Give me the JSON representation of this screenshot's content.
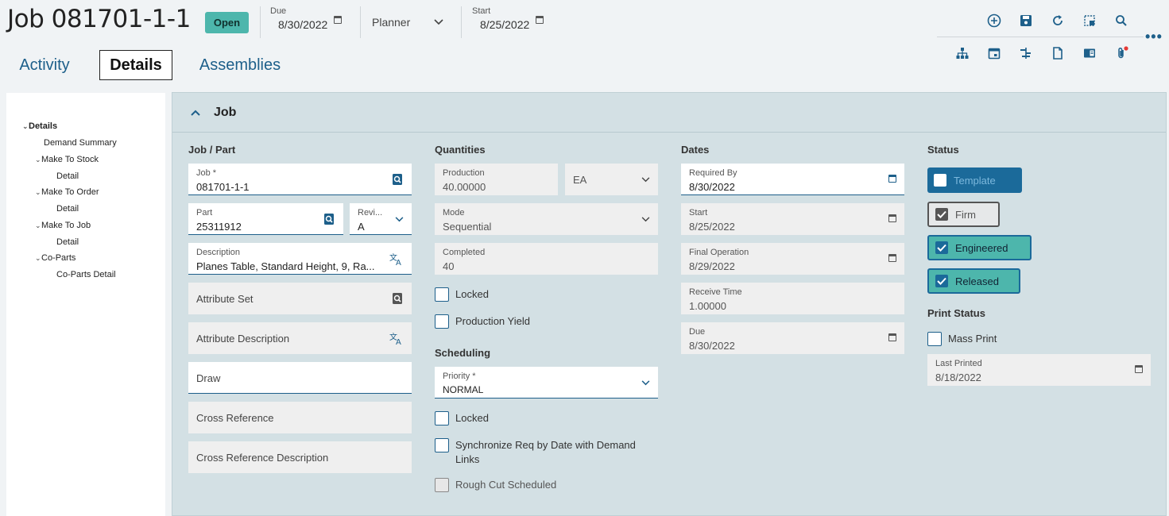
{
  "header": {
    "title": "Job 081701-1-1",
    "badge": "Open",
    "due_label": "Due",
    "due_value": "8/30/2022",
    "planner_label": "Planner",
    "start_label": "Start",
    "start_value": "8/25/2022"
  },
  "tabs": [
    {
      "label": "Activity"
    },
    {
      "label": "Details"
    },
    {
      "label": "Assemblies"
    }
  ],
  "tree": {
    "items": [
      {
        "label": "Details"
      },
      {
        "label": "Demand Summary"
      },
      {
        "label": "Make To Stock"
      },
      {
        "label": "Detail"
      },
      {
        "label": "Make To Order"
      },
      {
        "label": "Detail"
      },
      {
        "label": "Make To Job"
      },
      {
        "label": "Detail"
      },
      {
        "label": "Co-Parts"
      },
      {
        "label": "Co-Parts Detail"
      }
    ]
  },
  "panel": {
    "title": "Job",
    "job_part": {
      "section": "Job / Part",
      "job_label": "Job *",
      "job_value": "081701-1-1",
      "part_label": "Part",
      "part_value": "25311912",
      "rev_label": "Revi...",
      "rev_value": "A",
      "desc_label": "Description",
      "desc_value": "Planes Table, Standard Height, 9, Ra...",
      "attr_set": "Attribute Set",
      "attr_desc": "Attribute Description",
      "draw": "Draw",
      "cross_ref": "Cross Reference",
      "cross_ref_desc": "Cross Reference Description"
    },
    "quantities": {
      "section": "Quantities",
      "production_label": "Production",
      "production_value": "40.00000",
      "uom_value": "EA",
      "mode_label": "Mode",
      "mode_value": "Sequential",
      "completed_label": "Completed",
      "completed_value": "40",
      "locked": "Locked",
      "production_yield": "Production Yield"
    },
    "scheduling": {
      "section": "Scheduling",
      "priority_label": "Priority *",
      "priority_value": "NORMAL",
      "locked": "Locked",
      "sync": "Synchronize Req by Date with Demand Links",
      "rough_cut": "Rough Cut Scheduled"
    },
    "dates": {
      "section": "Dates",
      "required_by_label": "Required By",
      "required_by_value": "8/30/2022",
      "start_label": "Start",
      "start_value": "8/25/2022",
      "final_op_label": "Final Operation",
      "final_op_value": "8/29/2022",
      "receive_time_label": "Receive Time",
      "receive_time_value": "1.00000",
      "due_label": "Due",
      "due_value": "8/30/2022"
    },
    "status": {
      "section": "Status",
      "template": "Template",
      "firm": "Firm",
      "engineered": "Engineered",
      "released": "Released",
      "print_section": "Print Status",
      "mass_print": "Mass Print",
      "last_printed_label": "Last Printed",
      "last_printed_value": "8/18/2022"
    }
  },
  "colors": {
    "accent": "#1d5f8a",
    "teal": "#4db6ac",
    "panel_bg": "#d3e0e4"
  }
}
